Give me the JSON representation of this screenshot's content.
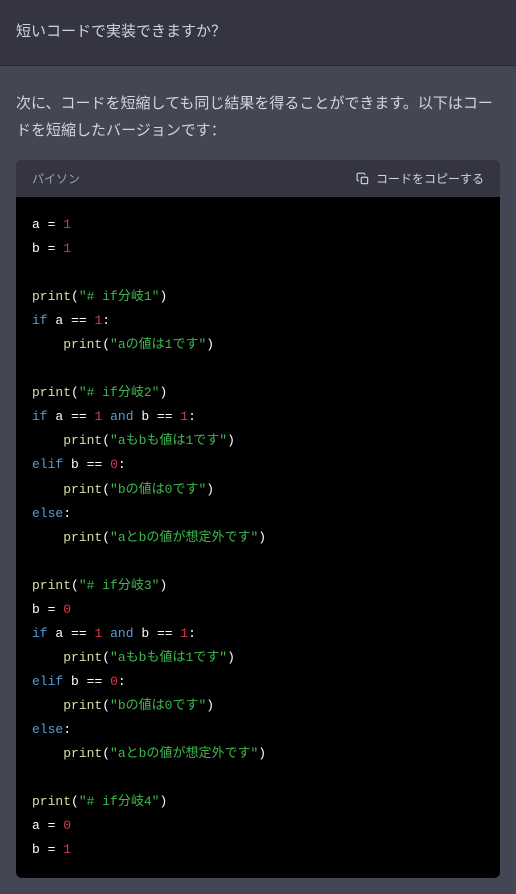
{
  "user_message": "短いコードで実装できますか？",
  "assistant_text": "次に、コードを短縮しても同じ結果を得ることができます。以下はコードを短縮したバージョンです：",
  "code_language_label": "パイソン",
  "copy_label": "コードをコピーする",
  "colors": {
    "background": "#343541",
    "assistant_background": "#444654",
    "code_background": "#000000",
    "keyword": "#569cd6",
    "function": "#dcdcaa",
    "string": "#3fb950",
    "number": "#d73a49",
    "default": "#ffffff"
  },
  "code": [
    [
      {
        "t": "var",
        "v": "a"
      },
      {
        "t": "sp",
        "v": " "
      },
      {
        "t": "op",
        "v": "="
      },
      {
        "t": "sp",
        "v": " "
      },
      {
        "t": "num",
        "v": "1"
      }
    ],
    [
      {
        "t": "var",
        "v": "b"
      },
      {
        "t": "sp",
        "v": " "
      },
      {
        "t": "op",
        "v": "="
      },
      {
        "t": "sp",
        "v": " "
      },
      {
        "t": "num",
        "v": "1"
      }
    ],
    [],
    [
      {
        "t": "func",
        "v": "print"
      },
      {
        "t": "paren",
        "v": "("
      },
      {
        "t": "str",
        "v": "\"# if分岐1\""
      },
      {
        "t": "paren",
        "v": ")"
      }
    ],
    [
      {
        "t": "kw",
        "v": "if"
      },
      {
        "t": "sp",
        "v": " "
      },
      {
        "t": "var",
        "v": "a"
      },
      {
        "t": "sp",
        "v": " "
      },
      {
        "t": "op",
        "v": "=="
      },
      {
        "t": "sp",
        "v": " "
      },
      {
        "t": "num",
        "v": "1"
      },
      {
        "t": "var",
        "v": ":"
      }
    ],
    [
      {
        "t": "sp",
        "v": "    "
      },
      {
        "t": "func",
        "v": "print"
      },
      {
        "t": "paren",
        "v": "("
      },
      {
        "t": "str",
        "v": "\"aの値は1です\""
      },
      {
        "t": "paren",
        "v": ")"
      }
    ],
    [],
    [
      {
        "t": "func",
        "v": "print"
      },
      {
        "t": "paren",
        "v": "("
      },
      {
        "t": "str",
        "v": "\"# if分岐2\""
      },
      {
        "t": "paren",
        "v": ")"
      }
    ],
    [
      {
        "t": "kw",
        "v": "if"
      },
      {
        "t": "sp",
        "v": " "
      },
      {
        "t": "var",
        "v": "a"
      },
      {
        "t": "sp",
        "v": " "
      },
      {
        "t": "op",
        "v": "=="
      },
      {
        "t": "sp",
        "v": " "
      },
      {
        "t": "num",
        "v": "1"
      },
      {
        "t": "sp",
        "v": " "
      },
      {
        "t": "kwop",
        "v": "and"
      },
      {
        "t": "sp",
        "v": " "
      },
      {
        "t": "var",
        "v": "b"
      },
      {
        "t": "sp",
        "v": " "
      },
      {
        "t": "op",
        "v": "=="
      },
      {
        "t": "sp",
        "v": " "
      },
      {
        "t": "num",
        "v": "1"
      },
      {
        "t": "var",
        "v": ":"
      }
    ],
    [
      {
        "t": "sp",
        "v": "    "
      },
      {
        "t": "func",
        "v": "print"
      },
      {
        "t": "paren",
        "v": "("
      },
      {
        "t": "str",
        "v": "\"aもbも値は1です\""
      },
      {
        "t": "paren",
        "v": ")"
      }
    ],
    [
      {
        "t": "kw",
        "v": "elif"
      },
      {
        "t": "sp",
        "v": " "
      },
      {
        "t": "var",
        "v": "b"
      },
      {
        "t": "sp",
        "v": " "
      },
      {
        "t": "op",
        "v": "=="
      },
      {
        "t": "sp",
        "v": " "
      },
      {
        "t": "num",
        "v": "0"
      },
      {
        "t": "var",
        "v": ":"
      }
    ],
    [
      {
        "t": "sp",
        "v": "    "
      },
      {
        "t": "func",
        "v": "print"
      },
      {
        "t": "paren",
        "v": "("
      },
      {
        "t": "str",
        "v": "\"bの値は0です\""
      },
      {
        "t": "paren",
        "v": ")"
      }
    ],
    [
      {
        "t": "kw",
        "v": "else"
      },
      {
        "t": "var",
        "v": ":"
      }
    ],
    [
      {
        "t": "sp",
        "v": "    "
      },
      {
        "t": "func",
        "v": "print"
      },
      {
        "t": "paren",
        "v": "("
      },
      {
        "t": "str",
        "v": "\"aとbの値が想定外です\""
      },
      {
        "t": "paren",
        "v": ")"
      }
    ],
    [],
    [
      {
        "t": "func",
        "v": "print"
      },
      {
        "t": "paren",
        "v": "("
      },
      {
        "t": "str",
        "v": "\"# if分岐3\""
      },
      {
        "t": "paren",
        "v": ")"
      }
    ],
    [
      {
        "t": "var",
        "v": "b"
      },
      {
        "t": "sp",
        "v": " "
      },
      {
        "t": "op",
        "v": "="
      },
      {
        "t": "sp",
        "v": " "
      },
      {
        "t": "num",
        "v": "0"
      }
    ],
    [
      {
        "t": "kw",
        "v": "if"
      },
      {
        "t": "sp",
        "v": " "
      },
      {
        "t": "var",
        "v": "a"
      },
      {
        "t": "sp",
        "v": " "
      },
      {
        "t": "op",
        "v": "=="
      },
      {
        "t": "sp",
        "v": " "
      },
      {
        "t": "num",
        "v": "1"
      },
      {
        "t": "sp",
        "v": " "
      },
      {
        "t": "kwop",
        "v": "and"
      },
      {
        "t": "sp",
        "v": " "
      },
      {
        "t": "var",
        "v": "b"
      },
      {
        "t": "sp",
        "v": " "
      },
      {
        "t": "op",
        "v": "=="
      },
      {
        "t": "sp",
        "v": " "
      },
      {
        "t": "num",
        "v": "1"
      },
      {
        "t": "var",
        "v": ":"
      }
    ],
    [
      {
        "t": "sp",
        "v": "    "
      },
      {
        "t": "func",
        "v": "print"
      },
      {
        "t": "paren",
        "v": "("
      },
      {
        "t": "str",
        "v": "\"aもbも値は1です\""
      },
      {
        "t": "paren",
        "v": ")"
      }
    ],
    [
      {
        "t": "kw",
        "v": "elif"
      },
      {
        "t": "sp",
        "v": " "
      },
      {
        "t": "var",
        "v": "b"
      },
      {
        "t": "sp",
        "v": " "
      },
      {
        "t": "op",
        "v": "=="
      },
      {
        "t": "sp",
        "v": " "
      },
      {
        "t": "num",
        "v": "0"
      },
      {
        "t": "var",
        "v": ":"
      }
    ],
    [
      {
        "t": "sp",
        "v": "    "
      },
      {
        "t": "func",
        "v": "print"
      },
      {
        "t": "paren",
        "v": "("
      },
      {
        "t": "str",
        "v": "\"bの値は0です\""
      },
      {
        "t": "paren",
        "v": ")"
      }
    ],
    [
      {
        "t": "kw",
        "v": "else"
      },
      {
        "t": "var",
        "v": ":"
      }
    ],
    [
      {
        "t": "sp",
        "v": "    "
      },
      {
        "t": "func",
        "v": "print"
      },
      {
        "t": "paren",
        "v": "("
      },
      {
        "t": "str",
        "v": "\"aとbの値が想定外です\""
      },
      {
        "t": "paren",
        "v": ")"
      }
    ],
    [],
    [
      {
        "t": "func",
        "v": "print"
      },
      {
        "t": "paren",
        "v": "("
      },
      {
        "t": "str",
        "v": "\"# if分岐4\""
      },
      {
        "t": "paren",
        "v": ")"
      }
    ],
    [
      {
        "t": "var",
        "v": "a"
      },
      {
        "t": "sp",
        "v": " "
      },
      {
        "t": "op",
        "v": "="
      },
      {
        "t": "sp",
        "v": " "
      },
      {
        "t": "num",
        "v": "0"
      }
    ],
    [
      {
        "t": "var",
        "v": "b"
      },
      {
        "t": "sp",
        "v": " "
      },
      {
        "t": "op",
        "v": "="
      },
      {
        "t": "sp",
        "v": " "
      },
      {
        "t": "num",
        "v": "1"
      }
    ]
  ]
}
